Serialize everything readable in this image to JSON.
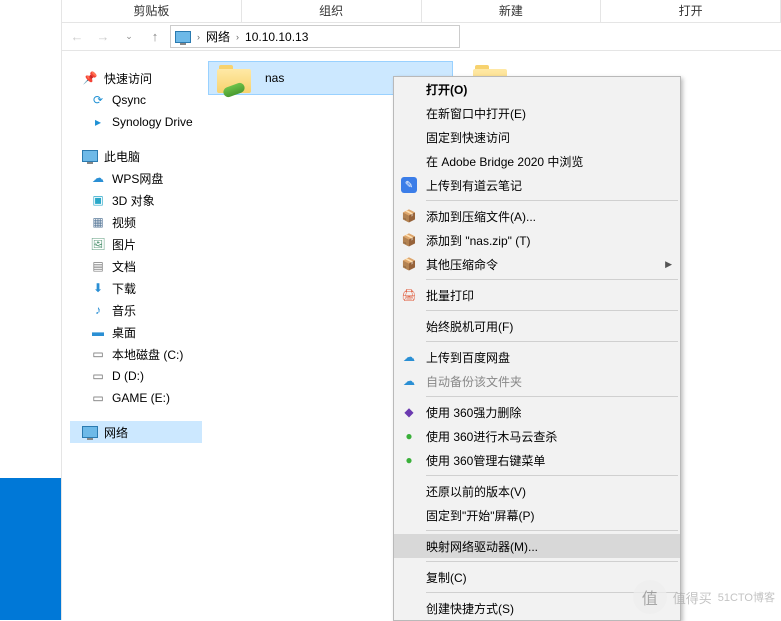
{
  "ribbon": {
    "t1": "剪贴板",
    "t2": "组织",
    "t3": "新建",
    "t4": "打开"
  },
  "address": {
    "root": "网络",
    "ip": "10.10.10.13"
  },
  "sidebar": {
    "quick": "快速访问",
    "qsync": "Qsync",
    "synology": "Synology Drive",
    "thispc": "此电脑",
    "wps": "WPS网盘",
    "d3": "3D 对象",
    "video": "视频",
    "pics": "图片",
    "docs": "文档",
    "downloads": "下载",
    "music": "音乐",
    "desktop": "桌面",
    "localc": "本地磁盘 (C:)",
    "dd": "D (D:)",
    "game": "GAME (E:)",
    "network": "网络"
  },
  "folders": {
    "nas": "nas"
  },
  "ctx": {
    "open": "打开(O)",
    "newwin": "在新窗口中打开(E)",
    "pinquick": "固定到快速访问",
    "bridge": "在 Adobe Bridge 2020 中浏览",
    "youdao": "上传到有道云笔记",
    "addarchive": "添加到压缩文件(A)...",
    "addnaszip": "添加到 \"nas.zip\" (T)",
    "othercompress": "其他压缩命令",
    "batchprint": "批量打印",
    "offline": "始终脱机可用(F)",
    "baidu": "上传到百度网盘",
    "autobackup": "自动备份该文件夹",
    "del360": "使用 360强力删除",
    "trojan360": "使用 360进行木马云查杀",
    "menu360": "使用 360管理右键菜单",
    "restore": "还原以前的版本(V)",
    "pinstart": "固定到\"开始\"屏幕(P)",
    "mapdrive": "映射网络驱动器(M)...",
    "copy": "复制(C)",
    "shortcut": "创建快捷方式(S)"
  },
  "watermark": {
    "text": "值得买",
    "blog": "51CTO博客"
  }
}
